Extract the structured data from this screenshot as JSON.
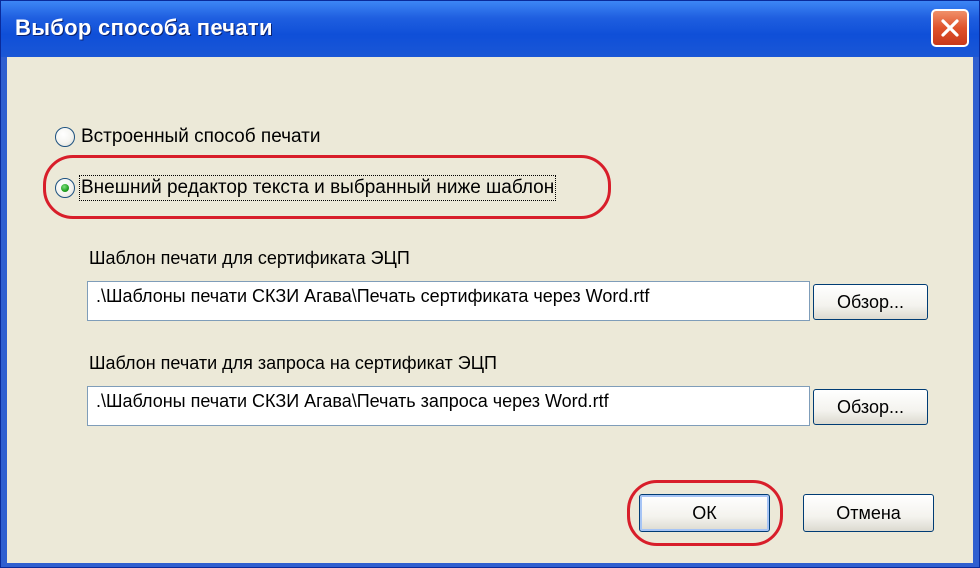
{
  "window": {
    "title": "Выбор способа печати",
    "close_icon": "close-x-icon"
  },
  "print_mode": {
    "options": [
      {
        "label": "Встроенный способ печати",
        "checked": false
      },
      {
        "label": "Внешний редактор текста и выбранный ниже шаблон",
        "checked": true
      }
    ]
  },
  "certificate_template": {
    "label": "Шаблон печати для сертификата ЭЦП",
    "value": ".\\Шаблоны печати СКЗИ Агава\\Печать сертификата через Word.rtf",
    "browse_label": "Обзор..."
  },
  "request_template": {
    "label": "Шаблон печати для запроса на сертификат ЭЦП",
    "value": ".\\Шаблоны печати СКЗИ Агава\\Печать запроса через Word.rtf",
    "browse_label": "Обзор..."
  },
  "footer": {
    "ok_label": "ОК",
    "cancel_label": "Отмена"
  },
  "colors": {
    "highlight_oval": "#d81e2a",
    "titlebar": "#1f5fe0",
    "dialog_bg": "#ece9d8"
  }
}
